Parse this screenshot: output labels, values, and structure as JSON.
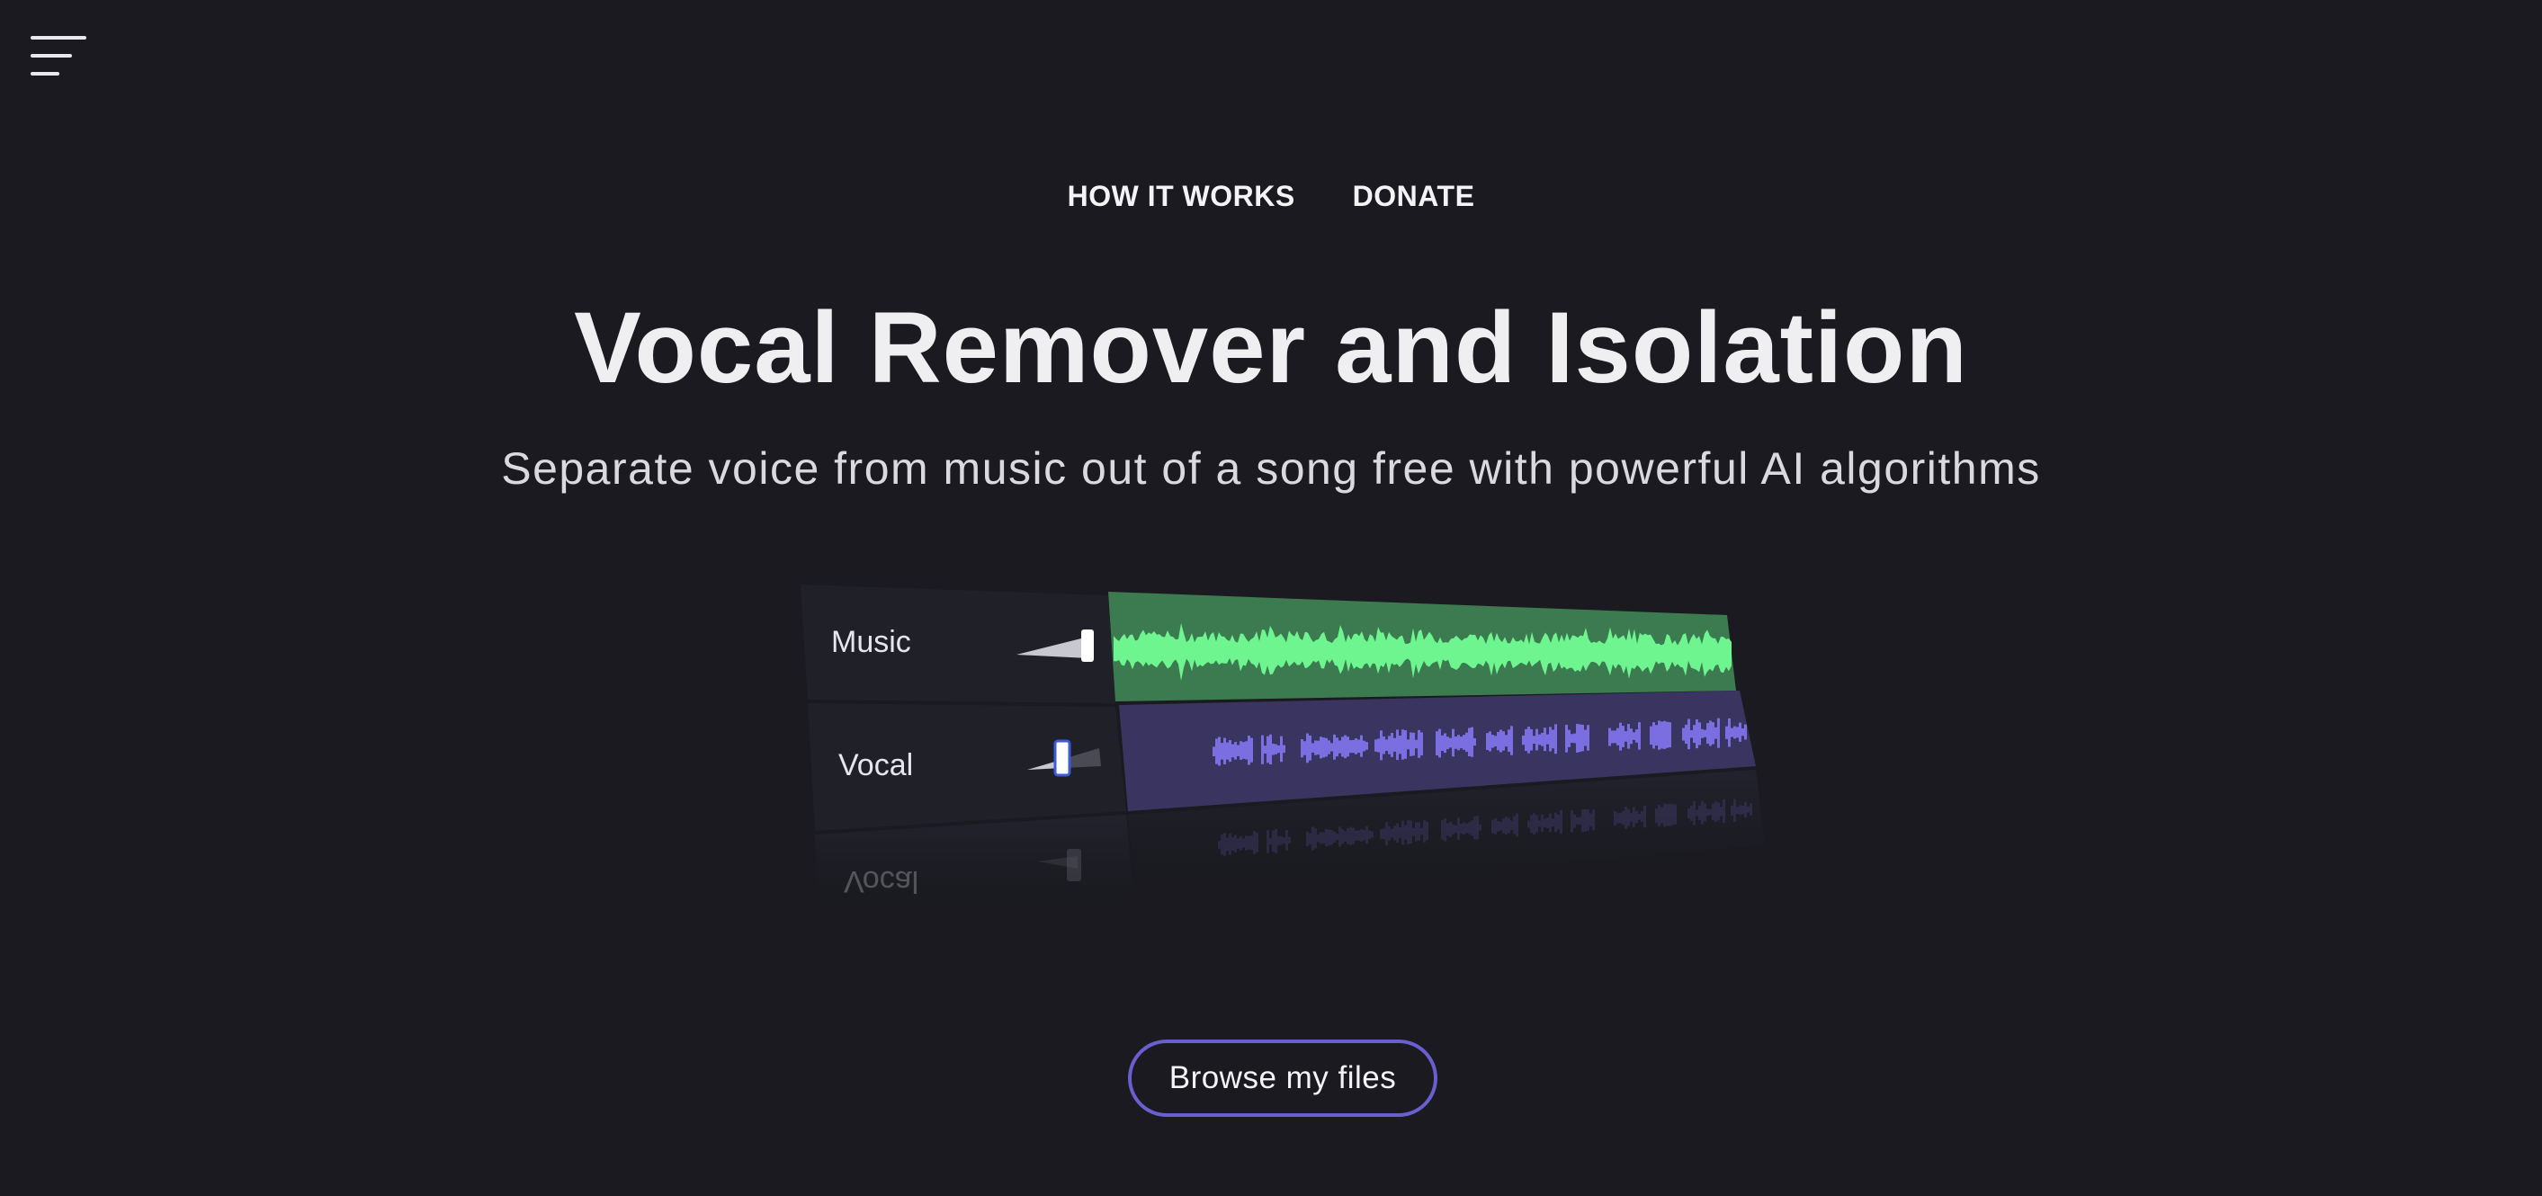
{
  "nav": {
    "menu_icon": "hamburger-menu-icon",
    "links": [
      "HOW IT WORKS",
      "DONATE"
    ]
  },
  "hero": {
    "title": "Vocal Remover and Isolation",
    "subtitle": "Separate voice from music out of a song free with powerful AI algorithms"
  },
  "mixer": {
    "tracks": [
      {
        "label": "Music",
        "color": "#6ef58f",
        "panel_color": "#3c7a50",
        "level": 1.0
      },
      {
        "label": "Vocal",
        "color": "#7b6ee0",
        "panel_color": "#3a3560",
        "level": 0.45
      }
    ],
    "reflection_label": "Vocal"
  },
  "upload": {
    "button_label": "Browse my files",
    "accent": "#6a5fd0"
  }
}
